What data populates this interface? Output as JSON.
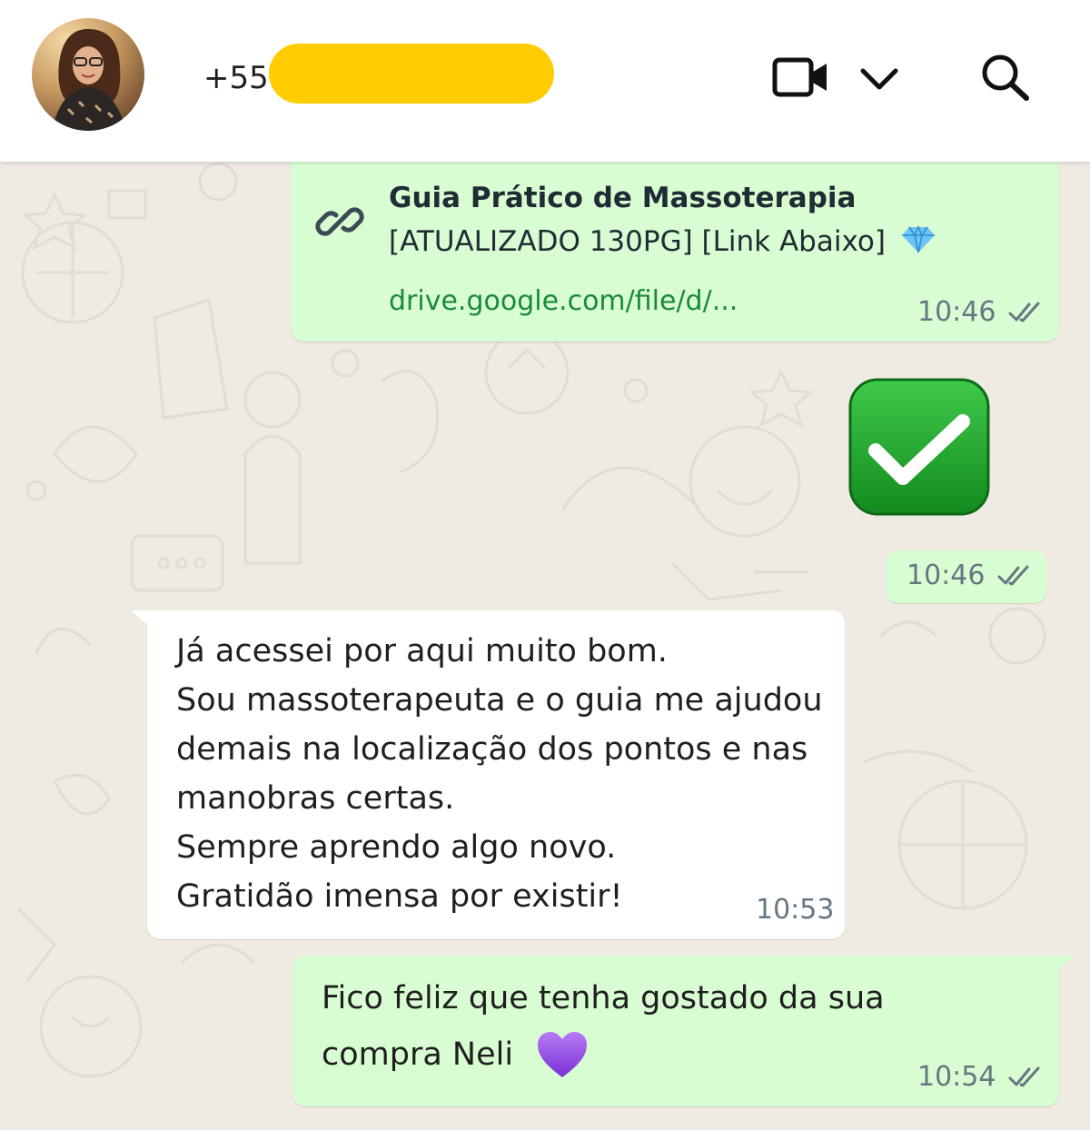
{
  "header": {
    "contact_prefix": "+55"
  },
  "messages": [
    {
      "type": "link",
      "direction": "outgoing",
      "title": "Guia Prático de Massoterapia",
      "subtitle": "[ATUALIZADO 130PG] [Link Abaixo]",
      "subtitle_emoji": "gem-emoji",
      "url": "drive.google.com/file/d/...",
      "time": "10:46",
      "status": "read"
    },
    {
      "type": "emoji",
      "direction": "outgoing",
      "emoji": "check-mark-button-emoji",
      "time": "10:46",
      "status": "read"
    },
    {
      "type": "text",
      "direction": "incoming",
      "lines": [
        "Já acessei por aqui muito bom.",
        "Sou massoterapeuta e o guia me ajudou",
        "demais na localização dos pontos e nas",
        "manobras certas.",
        "Sempre aprendo algo novo.",
        "Gratidão imensa por existir!"
      ],
      "time": "10:53"
    },
    {
      "type": "text",
      "direction": "outgoing",
      "lines": [
        "Fico feliz que tenha gostado da sua",
        "compra Neli"
      ],
      "trailing_emoji": "purple-heart-emoji",
      "time": "10:54",
      "status": "read"
    }
  ],
  "colors": {
    "outgoing_bubble": "#d9fdd3",
    "incoming_bubble": "#ffffff",
    "chat_background": "#efeae2",
    "link": "#1a8a3a",
    "redaction": "#ffcc00"
  }
}
